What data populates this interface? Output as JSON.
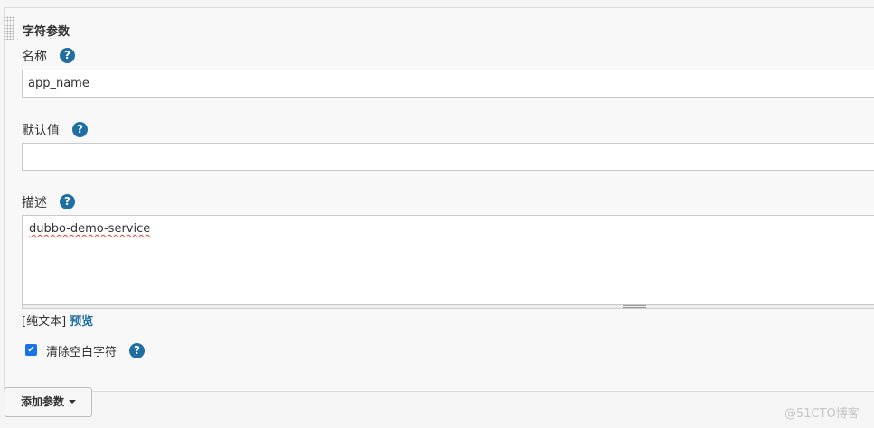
{
  "section": {
    "title": "字符参数"
  },
  "fields": {
    "name": {
      "label": "名称",
      "value": "app_name"
    },
    "default": {
      "label": "默认值",
      "value": ""
    },
    "description": {
      "label": "描述",
      "value": "dubbo-demo-service"
    }
  },
  "help_glyph": "?",
  "format_links": {
    "plain_text": "[纯文本]",
    "preview": "预览"
  },
  "trim": {
    "label": "清除空白字符",
    "checked": true,
    "check_glyph": "✔"
  },
  "add_param": {
    "label": "添加参数"
  },
  "watermark": "@51CTO博客",
  "colors": {
    "accent": "#1f6fa4",
    "checkbox": "#1a73e8",
    "panel_bg": "#f8f8f8"
  }
}
